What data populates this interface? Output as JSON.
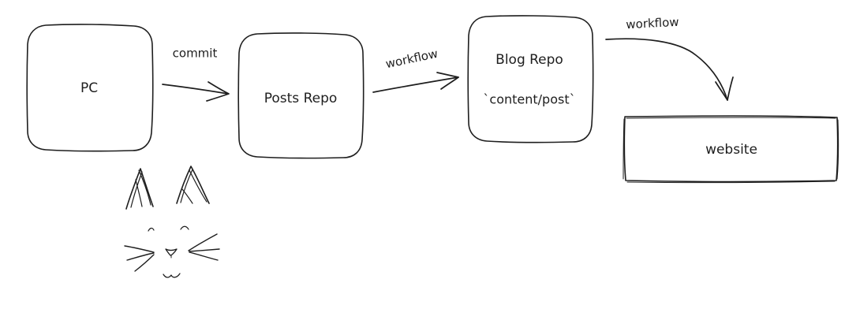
{
  "diagram": {
    "nodes": {
      "pc": {
        "label": "PC"
      },
      "posts_repo": {
        "label": "Posts Repo"
      },
      "blog_repo": {
        "label_line1": "Blog Repo",
        "label_line2": "`content/post`"
      },
      "website": {
        "label": "website"
      }
    },
    "edges": {
      "pc_to_posts": {
        "label": "commit"
      },
      "posts_to_blog": {
        "label": "workflow"
      },
      "blog_to_website": {
        "label": "workflow"
      }
    }
  },
  "colors": {
    "stroke": "#1e1e1e",
    "background": "#ffffff"
  },
  "icons": {
    "cat": "cat-face-doodle-icon"
  }
}
